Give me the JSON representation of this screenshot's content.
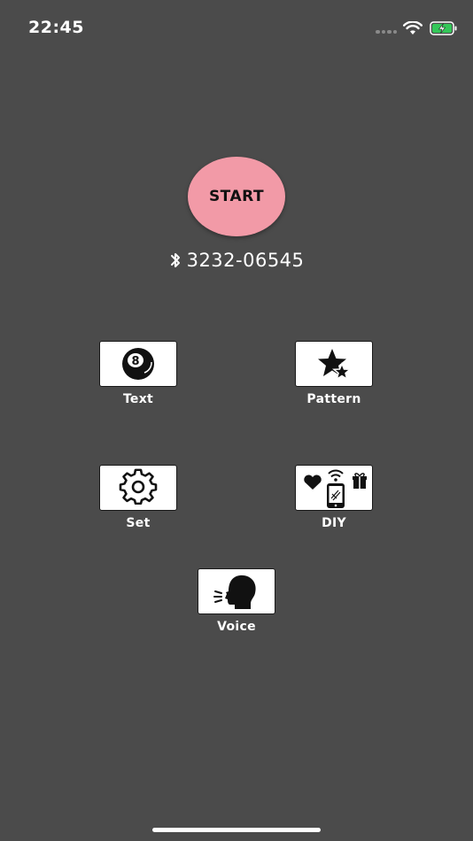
{
  "status_bar": {
    "time": "22:45",
    "battery_color": "#34c759"
  },
  "main": {
    "start_label": "START",
    "start_color": "#f29aa7",
    "device_id": "3232-06545"
  },
  "menu": {
    "text_label": "Text",
    "pattern_label": "Pattern",
    "set_label": "Set",
    "diy_label": "DIY",
    "voice_label": "Voice"
  },
  "icons": {
    "text": "eight-ball-icon",
    "pattern": "stars-icon",
    "set": "gear-icon",
    "diy": "phone-gifts-icon",
    "voice": "speaking-head-icon",
    "device": "bluetooth-icon"
  },
  "background_color": "#4b4b4b"
}
